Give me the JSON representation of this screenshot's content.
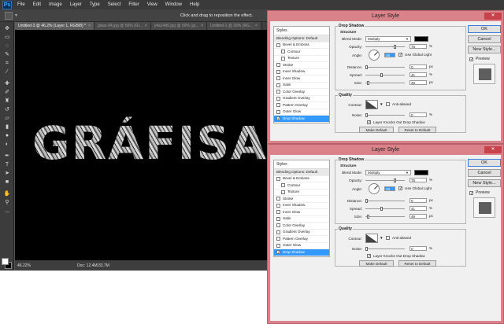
{
  "app": {
    "logo": "Ps",
    "menu": [
      "File",
      "Edit",
      "Image",
      "Layer",
      "Type",
      "Select",
      "Filter",
      "View",
      "Window",
      "Help"
    ],
    "options_status": "Click and drag to reposition the effect.",
    "tabs": [
      {
        "label": "Untitled-3 @ 46.2% (Layer 1, RGB/8) *",
        "active": true
      },
      {
        "label": "glass-94.jpg @ 50% (Gl...",
        "active": false
      },
      {
        "label": "y4a14d0.jpg @ 50% (gl...",
        "active": false
      },
      {
        "label": "Untitled-1 @ 29% (RG...",
        "active": false
      }
    ],
    "tab_close": "×",
    "canvas_text": "GRÁFISAI",
    "status_zoom": "46.22%",
    "status_doc": "Doc: 12.4M/33.7M",
    "colors": {
      "fg": "#ffffff",
      "bg": "#000000"
    }
  },
  "dialog": {
    "title": "Layer Style",
    "close": "✕",
    "styles_header": "Styles",
    "blending_options": "Blending Options: Default",
    "style_items": [
      {
        "label": "Bevel & Emboss",
        "checked": false,
        "sub": false,
        "selected": false
      },
      {
        "label": "Contour",
        "checked": false,
        "sub": true,
        "selected": false
      },
      {
        "label": "Texture",
        "checked": false,
        "sub": true,
        "selected": false
      },
      {
        "label": "Stroke",
        "checked": false,
        "sub": false,
        "selected": false
      },
      {
        "label": "Inner Shadow",
        "checked": false,
        "sub": false,
        "selected": false
      },
      {
        "label": "Inner Glow",
        "checked": false,
        "sub": false,
        "selected": false
      },
      {
        "label": "Satin",
        "checked": false,
        "sub": false,
        "selected": false
      },
      {
        "label": "Color Overlay",
        "checked": false,
        "sub": false,
        "selected": false
      },
      {
        "label": "Gradient Overlay",
        "checked": false,
        "sub": false,
        "selected": false
      },
      {
        "label": "Pattern Overlay",
        "checked": false,
        "sub": false,
        "selected": false
      },
      {
        "label": "Outer Glow",
        "checked": false,
        "sub": false,
        "selected": false
      },
      {
        "label": "Drop Shadow",
        "checked": true,
        "sub": false,
        "selected": true
      }
    ],
    "drop_shadow_title": "Drop Shadow",
    "structure_title": "Structure",
    "blend_mode_label": "Blend Mode:",
    "blend_mode_value": "Multiply",
    "shadow_color": "#000000",
    "opacity_label": "Opacity:",
    "opacity_value": "75",
    "angle_label": "Angle:",
    "angle_value": "45",
    "global_light_label": "Use Global Light",
    "distance_label": "Distance:",
    "distance_value": "0",
    "spread_label": "Spread:",
    "spread_value": "41",
    "size_label": "Size:",
    "size_value": "49",
    "quality_title": "Quality",
    "contour_label": "Contour:",
    "anti_aliased_label": "Anti-aliased",
    "noise_label": "Noise:",
    "noise_value": "0",
    "knockout_label": "Layer Knocks Out Drop Shadow",
    "make_default": "Make Default",
    "reset_default": "Reset to Default",
    "unit_percent": "%",
    "unit_px": "px",
    "ok": "OK",
    "cancel": "Cancel",
    "new_style": "New Style...",
    "preview": "Preview",
    "check_mark": "✓"
  }
}
